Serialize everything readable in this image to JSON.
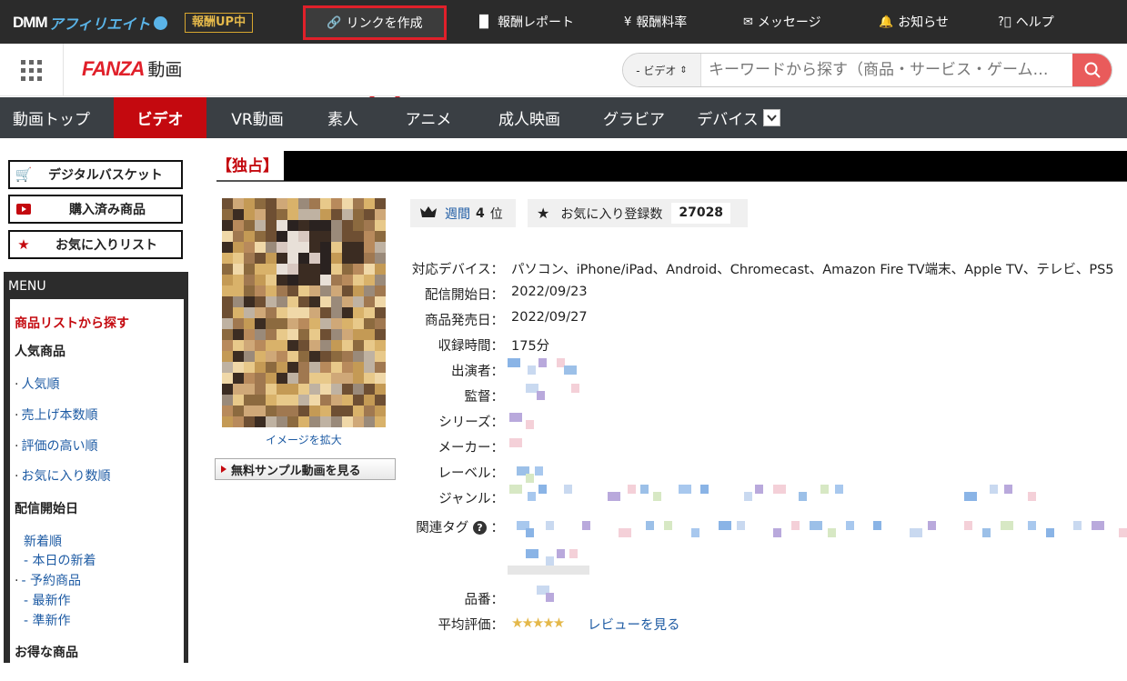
{
  "affiliate_bar": {
    "logo_dmm": "DMM",
    "logo_aff": "アフィリエイト",
    "badge": "報酬UP中",
    "nav": [
      {
        "icon": "link-icon",
        "label": "リンクを作成"
      },
      {
        "icon": "bar-chart-icon",
        "label": "報酬レポート"
      },
      {
        "icon": "yen-icon",
        "label": "報酬料率"
      },
      {
        "icon": "envelope-icon",
        "label": "メッセージ"
      },
      {
        "icon": "bell-icon",
        "label": "お知らせ"
      },
      {
        "icon": "help-circle-icon",
        "label": "ヘルプ"
      }
    ]
  },
  "header": {
    "logo": "FANZA",
    "logo_sub": "動画",
    "search": {
      "category": "- ビデオ",
      "placeholder": "キーワードから探す（商品・サービス・ゲーム…"
    }
  },
  "category_nav": {
    "items": [
      "動画トップ",
      "ビデオ",
      "VR動画",
      "素人",
      "アニメ",
      "成人映画",
      "グラビア",
      "デバイス"
    ],
    "active": "ビデオ"
  },
  "sidebar": {
    "buttons": [
      {
        "icon": "cart-icon",
        "label": "デジタルバスケット"
      },
      {
        "icon": "play-icon",
        "label": "購入済み商品"
      },
      {
        "icon": "star-icon",
        "label": "お気に入りリスト"
      }
    ],
    "menu_title": "MENU",
    "section_title": "商品リストから探す",
    "popular_title": "人気商品",
    "popular_items": [
      "人気順",
      "売上げ本数順",
      "評価の高い順",
      "お気に入り数順"
    ],
    "release_title": "配信開始日",
    "release_items": [
      "新着順",
      "- 本日の新着",
      "- 予約商品",
      "- 最新作",
      "- 準新作"
    ],
    "deals_title": "お得な商品"
  },
  "product": {
    "title_label": "【独占】",
    "zoom_link": "イメージを拡大",
    "sample_button": "無料サンプル動画を見る",
    "rank_period": "週間",
    "rank_value": "4",
    "rank_unit": "位",
    "favorites_label": "お気に入り登録数",
    "favorites_count": "27028",
    "details": [
      {
        "key": "対応デバイス：",
        "value": "パソコン、iPhone/iPad、Android、Chromecast、Amazon Fire TV端末、Apple TV、テレビ、PS5"
      },
      {
        "key": "配信開始日：",
        "value": "2022/09/23"
      },
      {
        "key": "商品発売日：",
        "value": "2022/09/27"
      },
      {
        "key": "収録時間：",
        "value": "175分"
      },
      {
        "key": "出演者：",
        "value": ""
      },
      {
        "key": "監督：",
        "value": ""
      },
      {
        "key": "シリーズ：",
        "value": ""
      },
      {
        "key": "メーカー：",
        "value": ""
      },
      {
        "key": "レーベル：",
        "value": ""
      },
      {
        "key": "ジャンル：",
        "value": ""
      },
      {
        "key": "関連タグ",
        "value": ""
      },
      {
        "key": "品番：",
        "value": ""
      },
      {
        "key": "平均評価：",
        "value": "レビューを見る"
      }
    ]
  },
  "colors": {
    "brand_red": "#c4090f",
    "dark_bar": "#2b2b2b",
    "nav_bar": "#3a3f44",
    "link_blue": "#1c5aa3",
    "highlight": "#e0202a"
  }
}
